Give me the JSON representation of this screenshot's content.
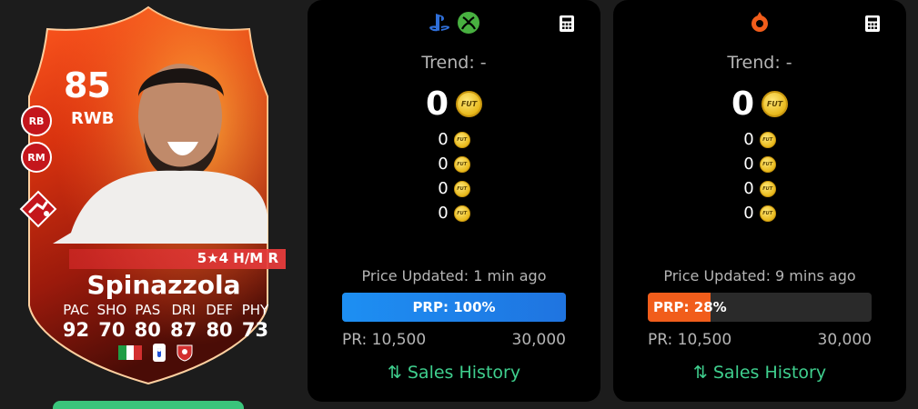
{
  "card": {
    "rating": "85",
    "position": "RWB",
    "alt_positions": [
      "RB",
      "RM"
    ],
    "skills": "5★4 H/M R",
    "name": "Spinazzola",
    "stats": [
      {
        "label": "PAC",
        "value": "92"
      },
      {
        "label": "SHO",
        "value": "70"
      },
      {
        "label": "PAS",
        "value": "80"
      },
      {
        "label": "DRI",
        "value": "87"
      },
      {
        "label": "DEF",
        "value": "80"
      },
      {
        "label": "PHY",
        "value": "73"
      }
    ],
    "nation_icon": "italy-flag-icon",
    "league_icon": "serie-a-icon",
    "club_icon": "club-crest-icon",
    "accent": "#e8401c"
  },
  "panels": [
    {
      "platform_icons": [
        "playstation-icon",
        "xbox-icon"
      ],
      "trend": "Trend: -",
      "price": "0",
      "sub_prices": [
        "0",
        "0",
        "0",
        "0"
      ],
      "coin_label": "FUT",
      "updated": "Price Updated: 1 min ago",
      "prp_label": "PRP: 100%",
      "prp_percent": 100,
      "prp_color": "#1d8ff3",
      "range_min": "PR: 10,500",
      "range_max": "30,000",
      "sales_history": "⇅ Sales History"
    },
    {
      "platform_icons": [
        "origin-pc-icon"
      ],
      "trend": "Trend: -",
      "price": "0",
      "sub_prices": [
        "0",
        "0",
        "0",
        "0"
      ],
      "coin_label": "FUT",
      "updated": "Price Updated: 9 mins ago",
      "prp_label": "PRP: 28%",
      "prp_percent": 28,
      "prp_color": "#f15d1b",
      "range_min": "PR: 10,500",
      "range_max": "30,000",
      "sales_history": "⇅ Sales History"
    }
  ]
}
